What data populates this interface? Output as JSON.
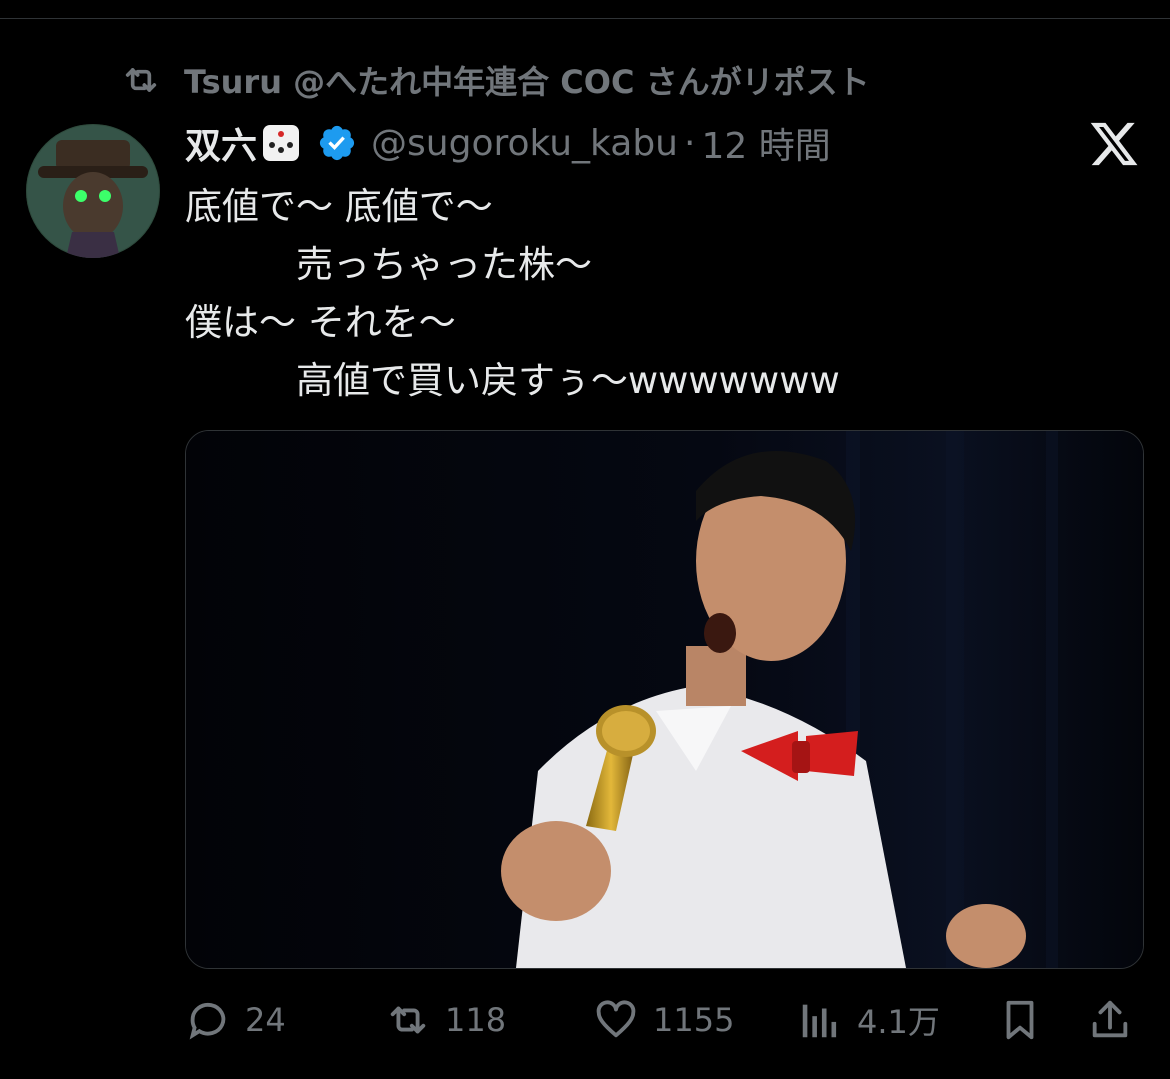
{
  "repost_header": {
    "text": "Tsuru @へたれ中年連合 COC さんがリポスト"
  },
  "tweet": {
    "display_name": "双六",
    "handle": "@sugoroku_kabu",
    "separator": "·",
    "time": "12 時間",
    "lines": [
      "底値で〜 底値で〜",
      "　　　売っちゃった株〜",
      "僕は〜 それを〜",
      "　　　高値で買い戻すぅ〜wwwwwww"
    ]
  },
  "actions": {
    "replies": "24",
    "reposts": "118",
    "likes": "1155",
    "views": "4.1万"
  },
  "colors": {
    "background": "#000000",
    "text": "#e7e9ea",
    "muted": "#71767b",
    "verified": "#1d9bf0"
  },
  "icons": [
    "repost-icon",
    "dice-icon",
    "verified-badge-icon",
    "x-logo-icon",
    "reply-icon",
    "like-icon",
    "views-icon",
    "bookmark-icon",
    "share-icon"
  ]
}
